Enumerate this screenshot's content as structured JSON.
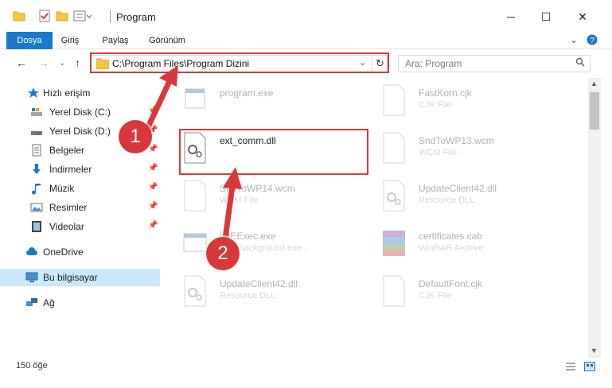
{
  "window": {
    "title": "Program",
    "minimize": "─",
    "maximize": "☐",
    "close": "✕"
  },
  "ribbon": {
    "tabs": [
      {
        "label": "Dosya",
        "active": true
      },
      {
        "label": "Giriş"
      },
      {
        "label": "Paylaş"
      },
      {
        "label": "Görünüm"
      }
    ],
    "expand_icon": "chevron-down-icon",
    "help_icon": "help-icon"
  },
  "nav": {
    "address": "C:\\Program Files\\Program Dizini",
    "search_placeholder": "Ara: Program"
  },
  "sidebar": {
    "items": [
      {
        "label": "Hızlı erişim",
        "icon": "star-icon"
      },
      {
        "label": "Yerel Disk (C:)",
        "icon": "drive-icon",
        "pinned": true
      },
      {
        "label": "Yerel Disk (D:)",
        "icon": "drive-icon",
        "pinned": true
      },
      {
        "label": "Belgeler",
        "icon": "documents-icon",
        "pinned": true
      },
      {
        "label": "İndirmeler",
        "icon": "download-icon",
        "pinned": true
      },
      {
        "label": "Müzik",
        "icon": "music-icon",
        "pinned": true
      },
      {
        "label": "Resimler",
        "icon": "pictures-icon",
        "pinned": true
      },
      {
        "label": "Videolar",
        "icon": "videos-icon",
        "pinned": true
      },
      {
        "label": "OneDrive",
        "icon": "cloud-icon"
      },
      {
        "label": "Bu bilgisayar",
        "icon": "computer-icon",
        "selected": true
      },
      {
        "label": "Ağ",
        "icon": "network-icon"
      }
    ]
  },
  "files": [
    {
      "name": "program.exe",
      "type": "",
      "icon": "exe-icon"
    },
    {
      "name": "FastKorn.cjk",
      "type": "CJK File",
      "icon": "file-icon"
    },
    {
      "name": "ext_comm.dll",
      "type": "",
      "icon": "dll-gear-icon"
    },
    {
      "name": "SndToWP13.wcm",
      "type": "WCM File",
      "icon": "file-icon"
    },
    {
      "name": "SndToWP14.wcm",
      "type": "WCM File",
      "icon": "file-icon"
    },
    {
      "name": "UpdateClient42.dll",
      "type": "Resource DLL",
      "icon": "dll-gear-icon"
    },
    {
      "name": "IMEExec.exe",
      "type": "WDI background exe...",
      "icon": "exe-icon"
    },
    {
      "name": "certificates.cab",
      "type": "WinRAR Archive",
      "icon": "archive-icon"
    },
    {
      "name": "UpdateClient42.dll",
      "type": "Resource DLL",
      "icon": "dll-gear-icon"
    },
    {
      "name": "DefaultFont.cjk",
      "type": "CJK File",
      "icon": "file-icon"
    }
  ],
  "status": {
    "count": "150 öğe"
  },
  "annotations": {
    "step1": "1",
    "step2": "2",
    "color": "#d9383a"
  },
  "colors": {
    "accent": "#1979ca",
    "selected": "#cce8ff"
  }
}
